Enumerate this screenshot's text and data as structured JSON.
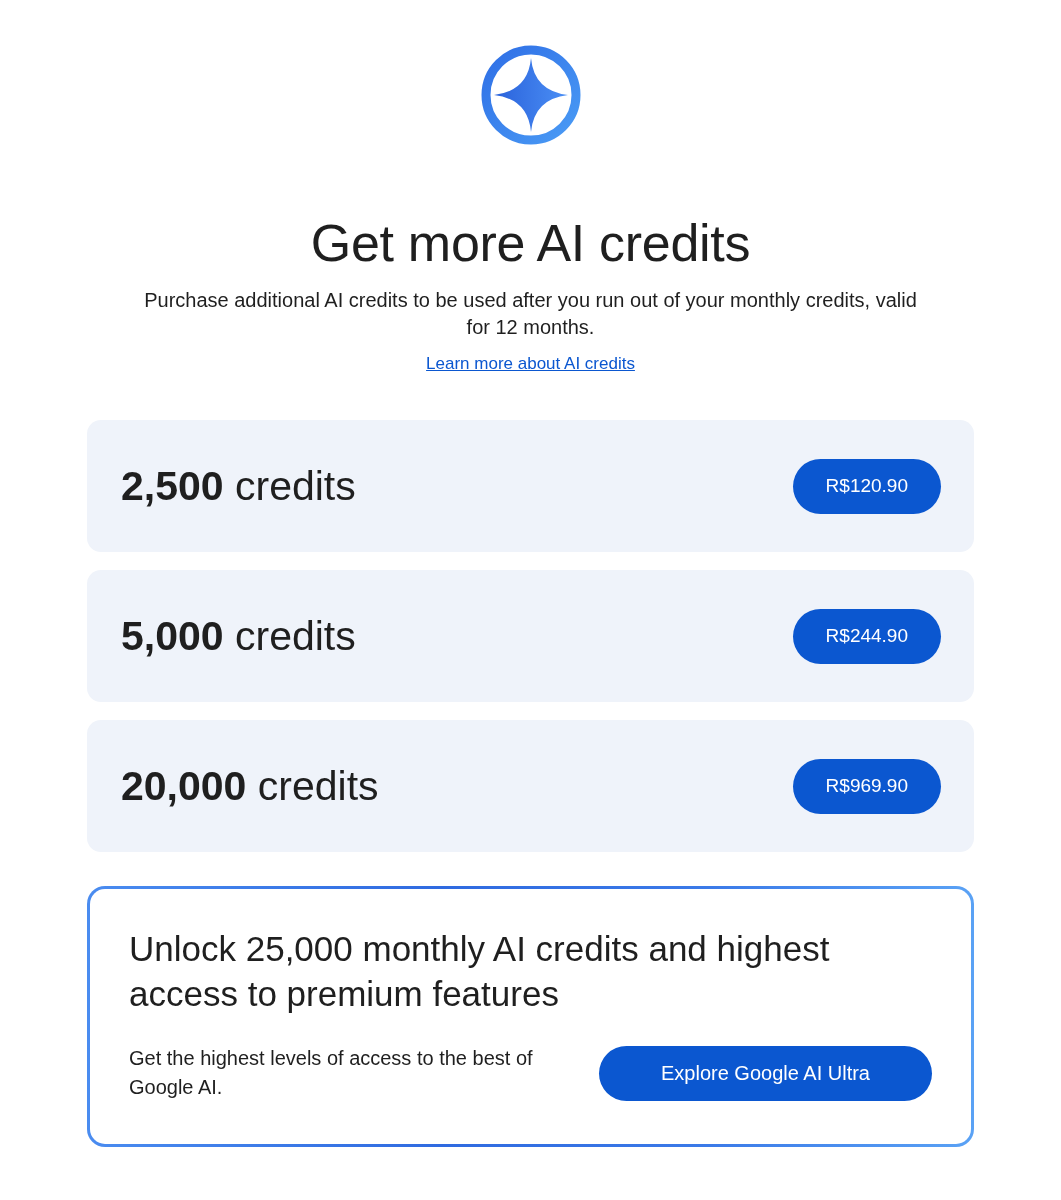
{
  "header": {
    "title": "Get more AI credits",
    "subtitle": "Purchase additional AI credits to be used after you run out of your monthly credits, valid for 12 months.",
    "link": "Learn more about AI credits"
  },
  "packs": [
    {
      "credits": "**2,500** credits",
      "price": "R$120.90"
    },
    {
      "credits": "**5,000** credits",
      "price": "R$244.90"
    },
    {
      "credits": "**20,000** credits",
      "price": "R$969.90"
    }
  ],
  "promo": {
    "heading": "Unlock 25,000 monthly AI credits and highest access to premium features",
    "description": "Get the highest levels of access to the best of Google AI.",
    "button": "Explore Google AI Ultra"
  }
}
